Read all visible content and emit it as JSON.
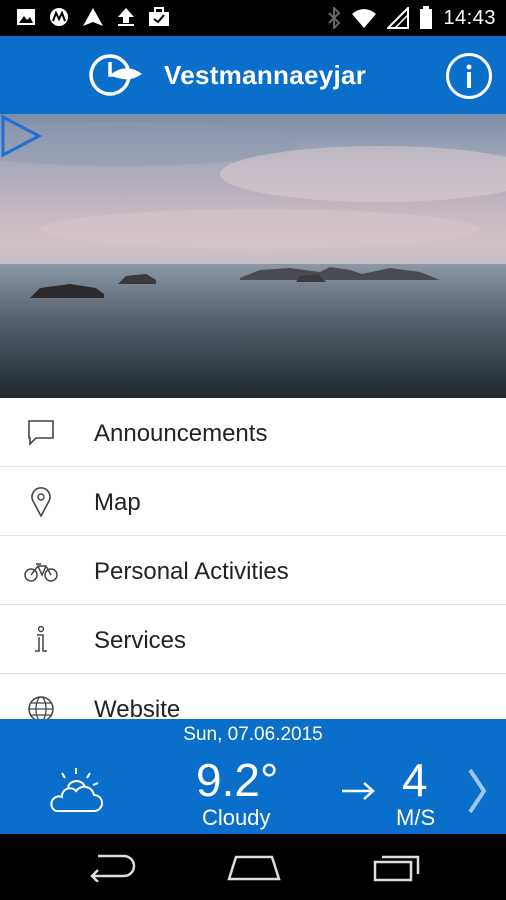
{
  "status_bar": {
    "time": "14:43",
    "left_icons": [
      "image-icon",
      "motorola-icon",
      "navigation-icon",
      "upload-icon",
      "briefcase-icon"
    ],
    "right_icons": [
      "bluetooth-icon",
      "wifi-icon",
      "cell-signal-icon",
      "battery-icon"
    ]
  },
  "app_bar": {
    "title": "Vestmannaeyjar",
    "logo_icon": "app-logo-icon",
    "info_icon": "info-icon"
  },
  "hero": {
    "play_icon": "play-icon"
  },
  "menu": {
    "items": [
      {
        "label": "Announcements",
        "icon": "speech-bubble-icon"
      },
      {
        "label": "Map",
        "icon": "map-pin-icon"
      },
      {
        "label": "Personal Activities",
        "icon": "bicycle-icon"
      },
      {
        "label": "Services",
        "icon": "info-i-icon"
      },
      {
        "label": "Website",
        "icon": "globe-icon"
      }
    ]
  },
  "weather": {
    "date": "Sun, 07.06.2015",
    "temperature": "9.2°",
    "condition": "Cloudy",
    "wind_speed": "4",
    "wind_unit": "M/S",
    "condition_icon": "cloud-sun-icon",
    "wind_direction_icon": "arrow-right-icon",
    "next_icon": "chevron-right-icon"
  },
  "nav_bar": {
    "icons": [
      "back-icon",
      "home-icon",
      "recents-icon"
    ]
  },
  "colors": {
    "brand_blue": "#0a6ecb",
    "status_bar": "#000000",
    "menu_text": "#222222"
  }
}
